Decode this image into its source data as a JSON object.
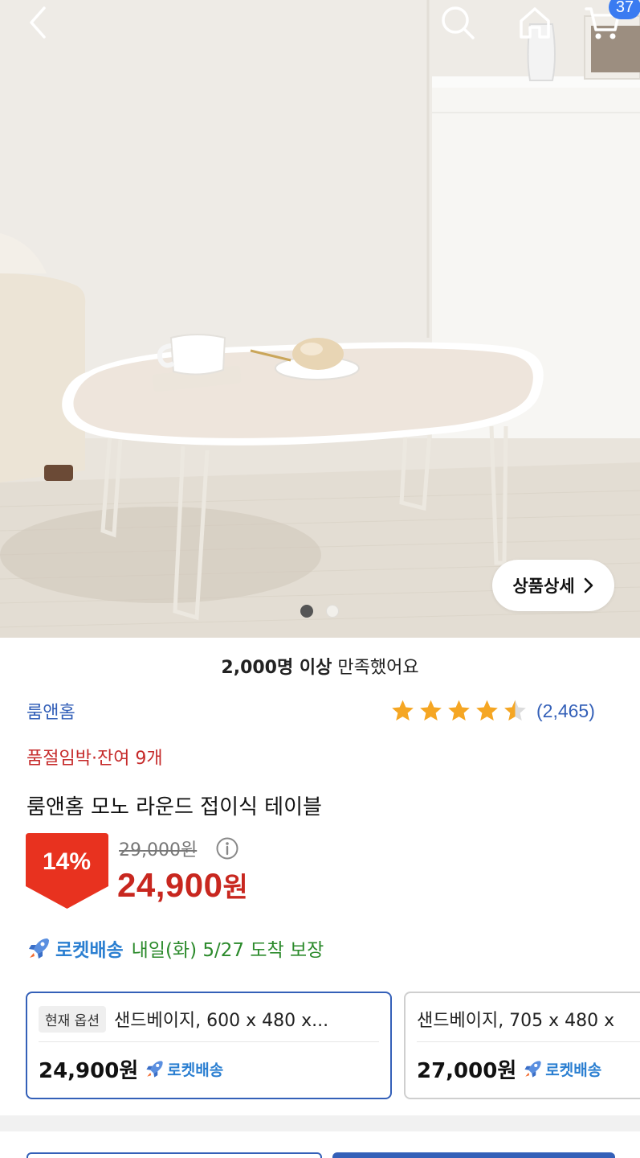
{
  "header": {
    "cart_count": "37",
    "icons": [
      "back-arrow-icon",
      "search-icon",
      "home-icon",
      "cart-icon"
    ]
  },
  "gallery": {
    "detail_button_label": "상품상세",
    "image_count": 2,
    "current_index": 1
  },
  "satisfaction": {
    "bold": "2,000명 이상",
    "rest": " 만족했어요"
  },
  "product": {
    "brand": "룸앤홈",
    "rating_value": 4.5,
    "rating_count": "(2,465)",
    "stock_notice": "품절임박·잔여 9개",
    "title": "룸앤홈 모노 라운드 접이식 테이블",
    "discount": "14%",
    "original_price": "29,000원",
    "sale_price_number": "24,900",
    "sale_price_unit": "원"
  },
  "delivery": {
    "label": "로켓배송",
    "eta": "내일(화) 5/27 도착 보장"
  },
  "options": [
    {
      "tag": "현재 옵션",
      "name": "샌드베이지, 600 x 480 x...",
      "price": "24,900원",
      "badge": "로켓배송"
    },
    {
      "name": "샌드베이지, 705 x 480 x",
      "price": "27,000원",
      "badge": "로켓배송"
    }
  ],
  "colors": {
    "accent_blue": "#3460b8",
    "price_red": "#c8271f",
    "stock_red": "#c62b2b",
    "rocket_blue": "#2b7fd1",
    "eta_green": "#2b8a2b",
    "star_gold": "#f5a623",
    "badge_blue": "#3a7bf1"
  }
}
